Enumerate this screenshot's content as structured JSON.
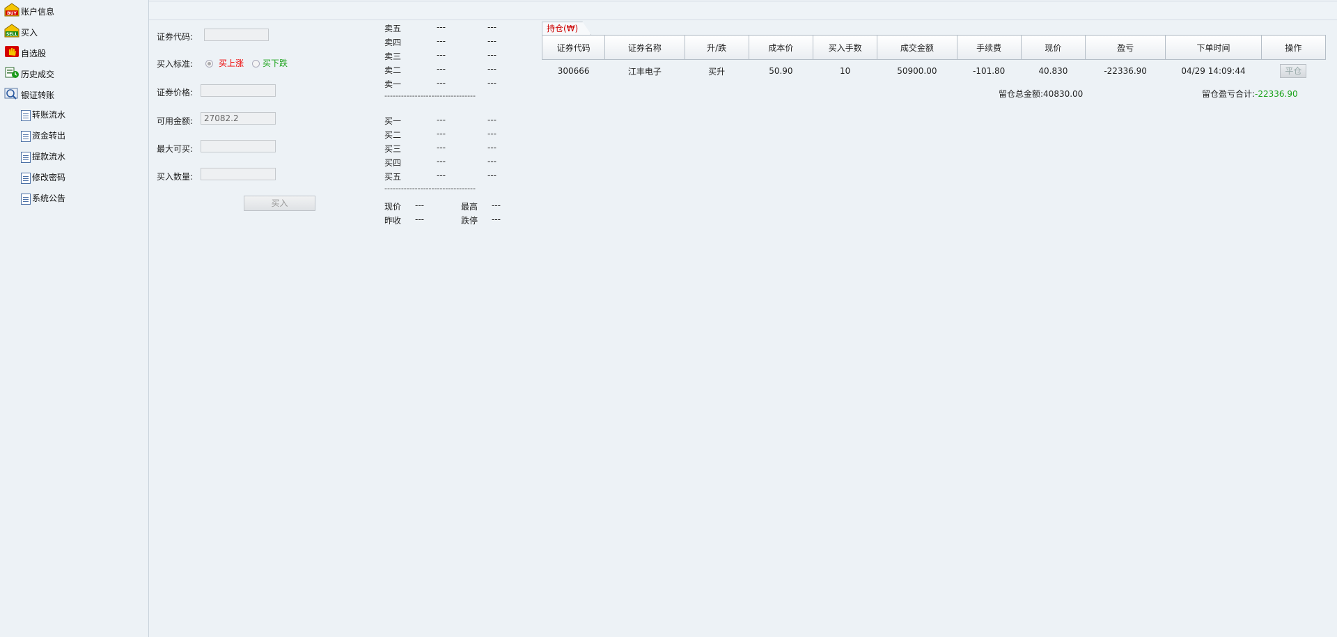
{
  "sidebar": {
    "items": [
      {
        "label": "账户信息",
        "icon": "buy-icon"
      },
      {
        "label": "买入",
        "icon": "sell-icon"
      },
      {
        "label": "自选股",
        "icon": "hand-icon"
      },
      {
        "label": "历史成交",
        "icon": "history-icon"
      },
      {
        "label": "银证转账",
        "icon": "bank-transfer-icon"
      }
    ],
    "subitems": [
      {
        "label": "转账流水"
      },
      {
        "label": "资金转出"
      },
      {
        "label": "提款流水"
      },
      {
        "label": "修改密码"
      },
      {
        "label": "系统公告"
      }
    ]
  },
  "form": {
    "code_label": "证券代码:",
    "code_value": "",
    "standard_label": "买入标准:",
    "opt_up": "买上涨",
    "opt_down": "买下跌",
    "price_label": "证券价格:",
    "price_value": "",
    "available_label": "可用金额:",
    "available_value": "27082.2",
    "max_label": "最大可买:",
    "max_value": "",
    "qty_label": "买入数量:",
    "qty_value": "",
    "buy_button": "买入"
  },
  "quote": {
    "sell": [
      {
        "label": "卖五",
        "price": "---",
        "vol": "---"
      },
      {
        "label": "卖四",
        "price": "---",
        "vol": "---"
      },
      {
        "label": "卖三",
        "price": "---",
        "vol": "---"
      },
      {
        "label": "卖二",
        "price": "---",
        "vol": "---"
      },
      {
        "label": "卖一",
        "price": "---",
        "vol": "---"
      }
    ],
    "buy": [
      {
        "label": "买一",
        "price": "---",
        "vol": "---"
      },
      {
        "label": "买二",
        "price": "---",
        "vol": "---"
      },
      {
        "label": "买三",
        "price": "---",
        "vol": "---"
      },
      {
        "label": "买四",
        "price": "---",
        "vol": "---"
      },
      {
        "label": "买五",
        "price": "---",
        "vol": "---"
      }
    ],
    "separator": "---------------------------------",
    "now_label": "现价",
    "now_value": "---",
    "high_label": "最高",
    "high_value": "---",
    "prev_label": "昨收",
    "prev_value": "---",
    "limit_down_label": "跌停",
    "limit_down_value": "---"
  },
  "positions": {
    "tab_label": "持仓(₩)",
    "headers": [
      "证券代码",
      "证券名称",
      "升/跌",
      "成本价",
      "买入手数",
      "成交金额",
      "手续费",
      "现价",
      "盈亏",
      "下单时间",
      "操作"
    ],
    "rows": [
      {
        "code": "300666",
        "name": "江丰电子",
        "direction": "买升",
        "cost": "50.90",
        "lots": "10",
        "amount": "50900.00",
        "fee": "-101.80",
        "price": "40.830",
        "pnl": "-22336.90",
        "time": "04/29 14:09:44",
        "action": "平仓"
      }
    ],
    "total_value_label": "留仓总金额:",
    "total_value": "40830.00",
    "total_pnl_label": "留仓盈亏合计:",
    "total_pnl": "-22336.90"
  },
  "colors": {
    "up": "#e00000",
    "down": "#1aa31a",
    "accent_tab": "#cc0000"
  }
}
